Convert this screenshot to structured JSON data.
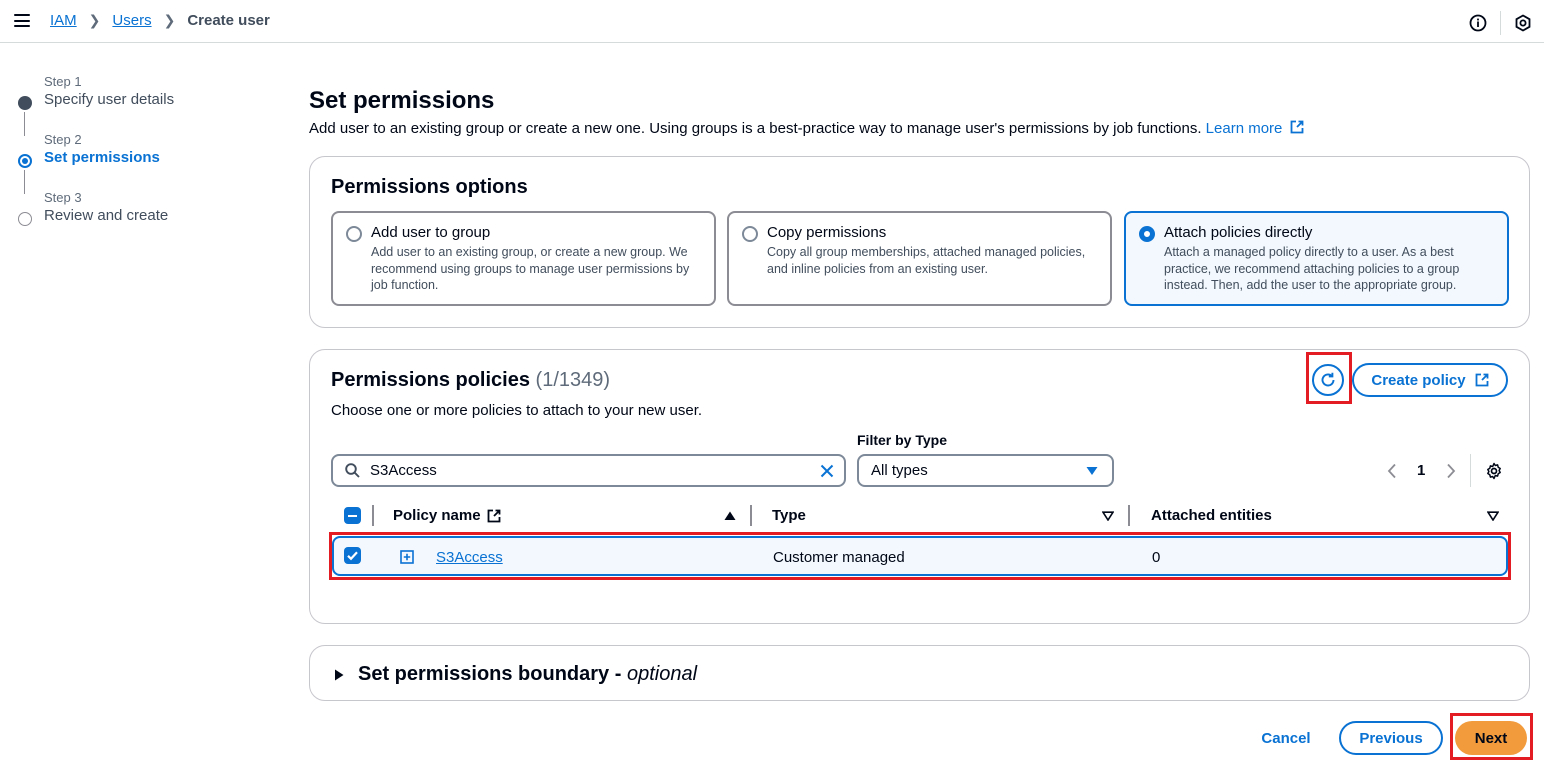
{
  "topbar": {
    "breadcrumbs": {
      "iam": "IAM",
      "users": "Users",
      "current": "Create user"
    },
    "icons": [
      "menu-icon",
      "info-icon",
      "settings-hex-icon"
    ]
  },
  "steps": [
    {
      "number": "Step 1",
      "label": "Specify user details",
      "state": "done"
    },
    {
      "number": "Step 2",
      "label": "Set permissions",
      "state": "current"
    },
    {
      "number": "Step 3",
      "label": "Review and create",
      "state": "todo"
    }
  ],
  "page": {
    "title": "Set permissions",
    "description": "Add user to an existing group or create a new one. Using groups is a best-practice way to manage user's permissions by job functions.",
    "learn_more": "Learn more"
  },
  "permission_options": {
    "heading": "Permissions options",
    "options": [
      {
        "title": "Add user to group",
        "desc": "Add user to an existing group, or create a new group. We recommend using groups to manage user permissions by job function.",
        "selected": false
      },
      {
        "title": "Copy permissions",
        "desc": "Copy all group memberships, attached managed policies, and inline policies from an existing user.",
        "selected": false
      },
      {
        "title": "Attach policies directly",
        "desc": "Attach a managed policy directly to a user. As a best practice, we recommend attaching policies to a group instead. Then, add the user to the appropriate group.",
        "selected": true
      }
    ]
  },
  "policies": {
    "heading": "Permissions policies",
    "count": "(1/1349)",
    "subtitle": "Choose one or more policies to attach to your new user.",
    "create_policy": "Create policy",
    "search_value": "S3Access",
    "filter_label": "Filter by Type",
    "filter_value": "All types",
    "page_number": "1",
    "columns": {
      "name": "Policy name",
      "type": "Type",
      "attached": "Attached entities"
    },
    "rows": [
      {
        "name": "S3Access",
        "type": "Customer managed",
        "attached": "0",
        "checked": true
      }
    ]
  },
  "boundary": {
    "title": "Set permissions boundary - ",
    "optional": "optional"
  },
  "footer": {
    "cancel": "Cancel",
    "previous": "Previous",
    "next": "Next"
  },
  "colors": {
    "accent": "#0972d3",
    "primary_button": "#f29b3d",
    "highlight": "#e31b23"
  }
}
